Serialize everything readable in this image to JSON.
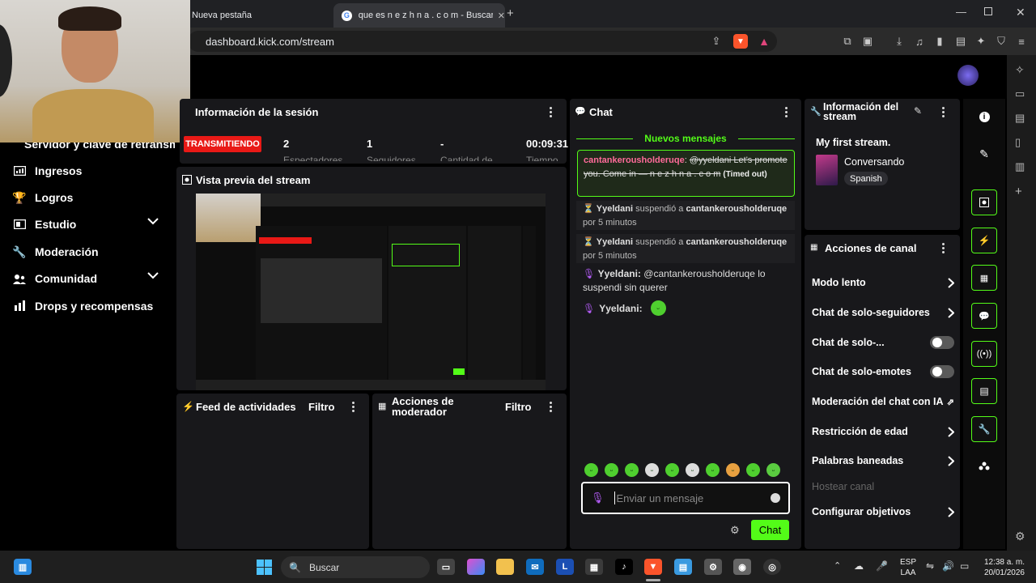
{
  "browser": {
    "tabs": [
      {
        "label": "Nueva pestaña"
      },
      {
        "label": "que es n e z h n a . c o m - Buscar co"
      }
    ],
    "url": "dashboard.kick.com/stream"
  },
  "sidebar": {
    "partial_item": "Servidor y clave de retransm",
    "items": [
      {
        "label": "Ingresos"
      },
      {
        "label": "Logros"
      },
      {
        "label": "Estudio"
      },
      {
        "label": "Moderación"
      },
      {
        "label": "Comunidad"
      },
      {
        "label": "Drops y recompensas"
      }
    ]
  },
  "session": {
    "title": "Información de la sesión",
    "live_badge": "TRANSMITIENDO",
    "stats": [
      {
        "value": "2",
        "label": "Espectadores"
      },
      {
        "value": "1",
        "label": "Seguidores"
      },
      {
        "value": "-",
        "label": "Cantidad de"
      },
      {
        "value": "00:09:31",
        "label": "Tiempo"
      }
    ]
  },
  "preview": {
    "title": "Vista previa del stream"
  },
  "activity_feed": {
    "title": "Feed de actividades",
    "filter": "Filtro"
  },
  "mod_actions": {
    "title_line1": "Acciones de",
    "title_line2": "moderador",
    "filter": "Filtro"
  },
  "chat": {
    "title": "Chat",
    "new_messages": "Nuevos mensajes",
    "timed_out_msg": {
      "user": "cantankerousholderuqe",
      "text_a": "@yyeldani Let's promote you. Come in — n e z h n a . c o m",
      "status": "(Timed out)"
    },
    "events": [
      {
        "mod": "Yyeldani",
        "action": "suspendió a",
        "target": "cantankerousholderuqe",
        "duration": "por 5 minutos"
      },
      {
        "mod": "Yyeldani",
        "action": "suspendió a",
        "target": "cantankerousholderuqe",
        "duration": "por 5 minutos"
      }
    ],
    "messages": [
      {
        "user": "Yyeldani:",
        "text": "@cantankerousholderuqe lo suspendi sin querer"
      },
      {
        "user": "Yyeldani:",
        "text": ""
      }
    ],
    "input_placeholder": "Enviar un mensaje",
    "send_label": "Chat"
  },
  "stream_info": {
    "title_line1": "Información del",
    "title_line2": "stream",
    "stream_title": "My first stream.",
    "category": "Conversando",
    "language": "Spanish"
  },
  "channel_actions": {
    "title": "Acciones de canal",
    "items": [
      {
        "label": "Modo lento",
        "control": "chevron"
      },
      {
        "label": "Chat de solo-seguidores",
        "control": "chevron"
      },
      {
        "label": "Chat de solo-...",
        "control": "toggle"
      },
      {
        "label": "Chat de solo-emotes",
        "control": "toggle"
      },
      {
        "label": "Moderación del chat con IA",
        "control": "external"
      },
      {
        "label": "Restricción de edad",
        "control": "chevron"
      },
      {
        "label": "Palabras baneadas",
        "control": "chevron"
      },
      {
        "label": "Hostear canal",
        "control": "disabled"
      },
      {
        "label": "Configurar objetivos",
        "control": "chevron"
      }
    ]
  },
  "taskbar": {
    "search": "Buscar",
    "lang_top": "ESP",
    "lang_bottom": "LAA",
    "time": "12:38 a. m.",
    "date": "20/01/2026"
  },
  "colors": {
    "kick_green": "#53fc18",
    "live_red": "#e91916",
    "panel_bg": "#18181b"
  }
}
